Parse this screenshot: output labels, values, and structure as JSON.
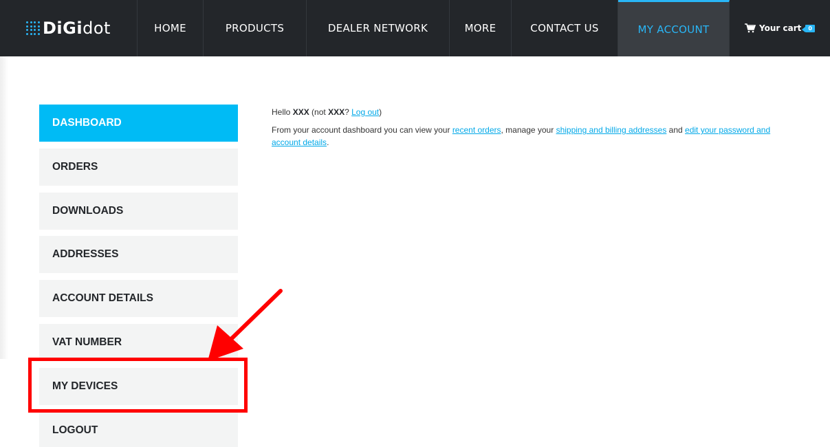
{
  "header": {
    "logo": {
      "part1": "DiGi",
      "part2": "dot"
    },
    "nav": {
      "home": "HOME",
      "products": "PRODUCTS",
      "dealer_network": "DEALER NETWORK",
      "more": "MORE",
      "contact_us": "CONTACT US",
      "my_account": "MY ACCOUNT"
    },
    "cart": {
      "label": "Your cart",
      "count": "0"
    }
  },
  "sidebar": {
    "items": [
      {
        "label": "DASHBOARD"
      },
      {
        "label": "ORDERS"
      },
      {
        "label": "DOWNLOADS"
      },
      {
        "label": "ADDRESSES"
      },
      {
        "label": "ACCOUNT DETAILS"
      },
      {
        "label": "VAT NUMBER"
      },
      {
        "label": "MY DEVICES"
      },
      {
        "label": "LOGOUT"
      }
    ]
  },
  "content": {
    "greeting": {
      "hello": "Hello ",
      "user": "XXX",
      "not": " (not ",
      "user2": "XXX",
      "q": "? ",
      "logout": "Log out",
      "close": ")"
    },
    "intro": {
      "t1": "From your account dashboard you can view your ",
      "l1": "recent orders",
      "t2": ", manage your ",
      "l2": "shipping and billing addresses",
      "t3": " and ",
      "l3": "edit your password and account details",
      "t4": "."
    }
  },
  "colors": {
    "accent": "#00bbf5",
    "nav_bg": "#23262a",
    "annotation": "#ff0000"
  }
}
